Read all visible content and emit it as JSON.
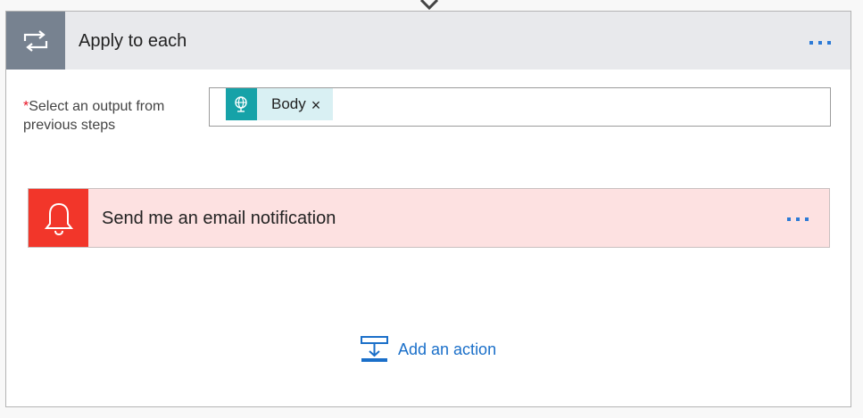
{
  "apply_each": {
    "title": "Apply to each",
    "icon": "loop-icon",
    "more_icon": "more-horizontal-icon"
  },
  "select_output": {
    "required_marker": "*",
    "label": "Select an output from previous steps",
    "token": {
      "label": "Body",
      "icon": "http-globe-icon",
      "remove": "×"
    }
  },
  "email_action": {
    "title": "Send me an email notification",
    "icon": "bell-icon",
    "more_icon": "more-horizontal-icon"
  },
  "add_action": {
    "label": "Add an action",
    "icon": "add-action-icon"
  },
  "colors": {
    "header_icon_bg": "#778290",
    "token_icon_bg": "#16a2a8",
    "email_icon_bg": "#f2362a",
    "email_card_bg": "#fde1e1",
    "link": "#1a6fc9"
  }
}
